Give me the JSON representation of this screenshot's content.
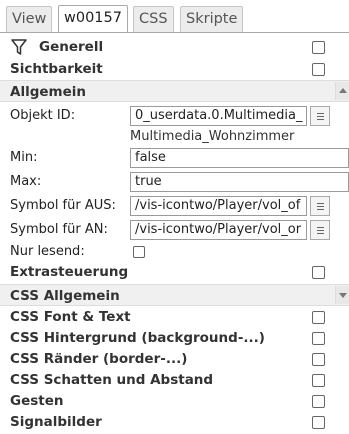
{
  "tabs": [
    {
      "label": "View"
    },
    {
      "label": "w00157"
    },
    {
      "label": "CSS"
    },
    {
      "label": "Skripte"
    }
  ],
  "filter_section": {
    "label": "Generell",
    "icon": "filter-icon"
  },
  "sections": {
    "sichtbarkeit": "Sichtbarkeit",
    "allgemein": "Allgemein",
    "extrasteuerung": "Extrasteuerung",
    "css_allgemein": "CSS Allgemein",
    "css_font": "CSS Font & Text",
    "css_hintergrund": "CSS Hintergrund (background-...)",
    "css_raender": "CSS Ränder (border-...)",
    "css_schatten": "CSS Schatten und Abstand",
    "gesten": "Gesten",
    "signalbilder": "Signalbilder"
  },
  "fields": {
    "objekt_id": {
      "label": "Objekt ID:",
      "value": "0_userdata.0.Multimedia_",
      "sub": "Multimedia_Wohnzimmer"
    },
    "min": {
      "label": "Min:",
      "value": "false"
    },
    "max": {
      "label": "Max:",
      "value": "true"
    },
    "symbol_aus": {
      "label": "Symbol für AUS:",
      "value": "/vis-icontwo/Player/vol_of"
    },
    "symbol_an": {
      "label": "Symbol für AN:",
      "value": "/vis-icontwo/Player/vol_or"
    },
    "nur_lesend": {
      "label": "Nur lesend:"
    }
  }
}
